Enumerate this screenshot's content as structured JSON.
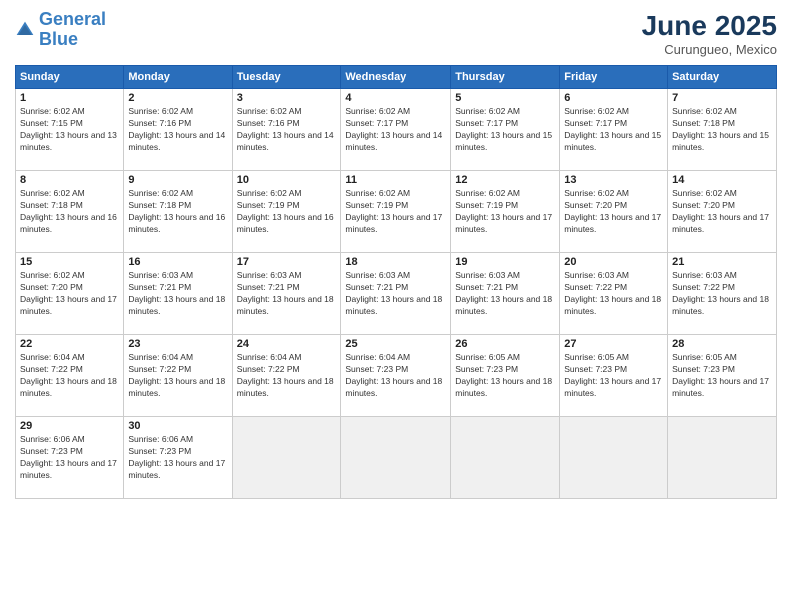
{
  "logo": {
    "line1": "General",
    "line2": "Blue"
  },
  "title": "June 2025",
  "location": "Curungueo, Mexico",
  "days_of_week": [
    "Sunday",
    "Monday",
    "Tuesday",
    "Wednesday",
    "Thursday",
    "Friday",
    "Saturday"
  ],
  "weeks": [
    [
      {
        "day": "1",
        "info": "Sunrise: 6:02 AM\nSunset: 7:15 PM\nDaylight: 13 hours and 13 minutes."
      },
      {
        "day": "2",
        "info": "Sunrise: 6:02 AM\nSunset: 7:16 PM\nDaylight: 13 hours and 14 minutes."
      },
      {
        "day": "3",
        "info": "Sunrise: 6:02 AM\nSunset: 7:16 PM\nDaylight: 13 hours and 14 minutes."
      },
      {
        "day": "4",
        "info": "Sunrise: 6:02 AM\nSunset: 7:17 PM\nDaylight: 13 hours and 14 minutes."
      },
      {
        "day": "5",
        "info": "Sunrise: 6:02 AM\nSunset: 7:17 PM\nDaylight: 13 hours and 15 minutes."
      },
      {
        "day": "6",
        "info": "Sunrise: 6:02 AM\nSunset: 7:17 PM\nDaylight: 13 hours and 15 minutes."
      },
      {
        "day": "7",
        "info": "Sunrise: 6:02 AM\nSunset: 7:18 PM\nDaylight: 13 hours and 15 minutes."
      }
    ],
    [
      {
        "day": "8",
        "info": "Sunrise: 6:02 AM\nSunset: 7:18 PM\nDaylight: 13 hours and 16 minutes."
      },
      {
        "day": "9",
        "info": "Sunrise: 6:02 AM\nSunset: 7:18 PM\nDaylight: 13 hours and 16 minutes."
      },
      {
        "day": "10",
        "info": "Sunrise: 6:02 AM\nSunset: 7:19 PM\nDaylight: 13 hours and 16 minutes."
      },
      {
        "day": "11",
        "info": "Sunrise: 6:02 AM\nSunset: 7:19 PM\nDaylight: 13 hours and 17 minutes."
      },
      {
        "day": "12",
        "info": "Sunrise: 6:02 AM\nSunset: 7:19 PM\nDaylight: 13 hours and 17 minutes."
      },
      {
        "day": "13",
        "info": "Sunrise: 6:02 AM\nSunset: 7:20 PM\nDaylight: 13 hours and 17 minutes."
      },
      {
        "day": "14",
        "info": "Sunrise: 6:02 AM\nSunset: 7:20 PM\nDaylight: 13 hours and 17 minutes."
      }
    ],
    [
      {
        "day": "15",
        "info": "Sunrise: 6:02 AM\nSunset: 7:20 PM\nDaylight: 13 hours and 17 minutes."
      },
      {
        "day": "16",
        "info": "Sunrise: 6:03 AM\nSunset: 7:21 PM\nDaylight: 13 hours and 18 minutes."
      },
      {
        "day": "17",
        "info": "Sunrise: 6:03 AM\nSunset: 7:21 PM\nDaylight: 13 hours and 18 minutes."
      },
      {
        "day": "18",
        "info": "Sunrise: 6:03 AM\nSunset: 7:21 PM\nDaylight: 13 hours and 18 minutes."
      },
      {
        "day": "19",
        "info": "Sunrise: 6:03 AM\nSunset: 7:21 PM\nDaylight: 13 hours and 18 minutes."
      },
      {
        "day": "20",
        "info": "Sunrise: 6:03 AM\nSunset: 7:22 PM\nDaylight: 13 hours and 18 minutes."
      },
      {
        "day": "21",
        "info": "Sunrise: 6:03 AM\nSunset: 7:22 PM\nDaylight: 13 hours and 18 minutes."
      }
    ],
    [
      {
        "day": "22",
        "info": "Sunrise: 6:04 AM\nSunset: 7:22 PM\nDaylight: 13 hours and 18 minutes."
      },
      {
        "day": "23",
        "info": "Sunrise: 6:04 AM\nSunset: 7:22 PM\nDaylight: 13 hours and 18 minutes."
      },
      {
        "day": "24",
        "info": "Sunrise: 6:04 AM\nSunset: 7:22 PM\nDaylight: 13 hours and 18 minutes."
      },
      {
        "day": "25",
        "info": "Sunrise: 6:04 AM\nSunset: 7:23 PM\nDaylight: 13 hours and 18 minutes."
      },
      {
        "day": "26",
        "info": "Sunrise: 6:05 AM\nSunset: 7:23 PM\nDaylight: 13 hours and 18 minutes."
      },
      {
        "day": "27",
        "info": "Sunrise: 6:05 AM\nSunset: 7:23 PM\nDaylight: 13 hours and 17 minutes."
      },
      {
        "day": "28",
        "info": "Sunrise: 6:05 AM\nSunset: 7:23 PM\nDaylight: 13 hours and 17 minutes."
      }
    ],
    [
      {
        "day": "29",
        "info": "Sunrise: 6:06 AM\nSunset: 7:23 PM\nDaylight: 13 hours and 17 minutes."
      },
      {
        "day": "30",
        "info": "Sunrise: 6:06 AM\nSunset: 7:23 PM\nDaylight: 13 hours and 17 minutes."
      },
      null,
      null,
      null,
      null,
      null
    ]
  ]
}
